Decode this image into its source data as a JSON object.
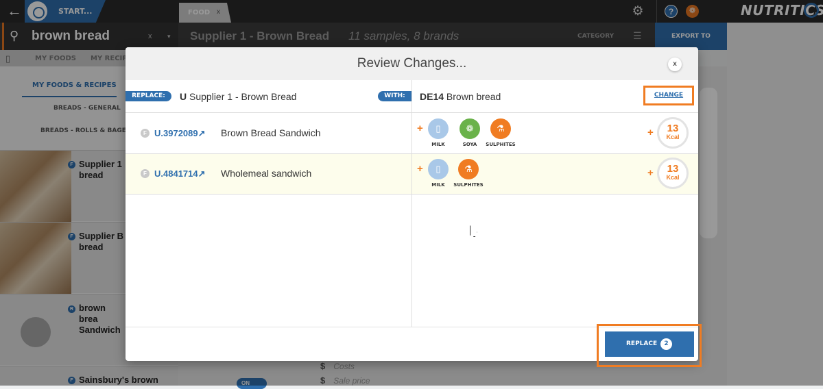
{
  "topbar": {
    "start_label": "START...",
    "tab_label": "FOOD",
    "tab_close": "x",
    "brand": "NUTRITICS",
    "help": "?",
    "gift": "❁"
  },
  "searchbar": {
    "query": "brown bread",
    "clear": "x",
    "caret": "▾",
    "title": "Supplier 1 - Brown Bread",
    "subtitle": "11 samples, 8 brands",
    "category": "CATEGORY",
    "export": "EXPORT TO"
  },
  "subnav": {
    "items": [
      "MY FOODS",
      "MY RECIPE"
    ]
  },
  "leftpanel": {
    "tab": "MY FOODS & RECIPES",
    "categories": [
      "BREADS - GENERAL",
      "BREADS - ROLLS & BAGEL"
    ],
    "foods": [
      {
        "badge": "F",
        "name": "Supplier 1 bread"
      },
      {
        "badge": "F",
        "name": "Supplier B bread"
      },
      {
        "badge": "R",
        "name": "brown brea Sandwich"
      },
      {
        "badge": "F",
        "name": "Sainsbury's brown"
      }
    ]
  },
  "background": {
    "costs": "Costs",
    "sale_price": "Sale price",
    "currency": "$",
    "toggle": "ON"
  },
  "modal": {
    "title": "Review Changes...",
    "close": "x",
    "replace_pill": "REPLACE:",
    "with_pill": "WITH:",
    "replace_prefix": "U",
    "replace_name": "Supplier 1 - Brown Bread",
    "with_prefix": "DE14",
    "with_name": "Brown bread",
    "change": "CHANGE",
    "rows": [
      {
        "badge": "F",
        "code": "U.3972089↗",
        "name": "Brown Bread Sandwich",
        "allergens": [
          {
            "label": "MILK",
            "icon": "milk-icon",
            "color": "#a9c8e8",
            "glyph": "▯"
          },
          {
            "label": "SOYA",
            "icon": "soya-icon",
            "color": "#6ab24a",
            "glyph": "❁"
          },
          {
            "label": "SULPHITES",
            "icon": "sulphites-icon",
            "color": "#f07c22",
            "glyph": "⚗"
          }
        ],
        "kcal": "13",
        "kcal_unit": "Kcal"
      },
      {
        "badge": "F",
        "code": "U.4841714↗",
        "name": "Wholemeal sandwich",
        "allergens": [
          {
            "label": "MILK",
            "icon": "milk-icon",
            "color": "#a9c8e8",
            "glyph": "▯"
          },
          {
            "label": "SULPHITES",
            "icon": "sulphites-icon",
            "color": "#f07c22",
            "glyph": "⚗"
          }
        ],
        "kcal": "13",
        "kcal_unit": "Kcal"
      }
    ],
    "plus": "+",
    "replace_button": "REPLACE",
    "replace_count": "2"
  },
  "colors": {
    "accent": "#2f6fae",
    "highlight": "#f07c22",
    "row_highlight": "#fdfdec"
  }
}
